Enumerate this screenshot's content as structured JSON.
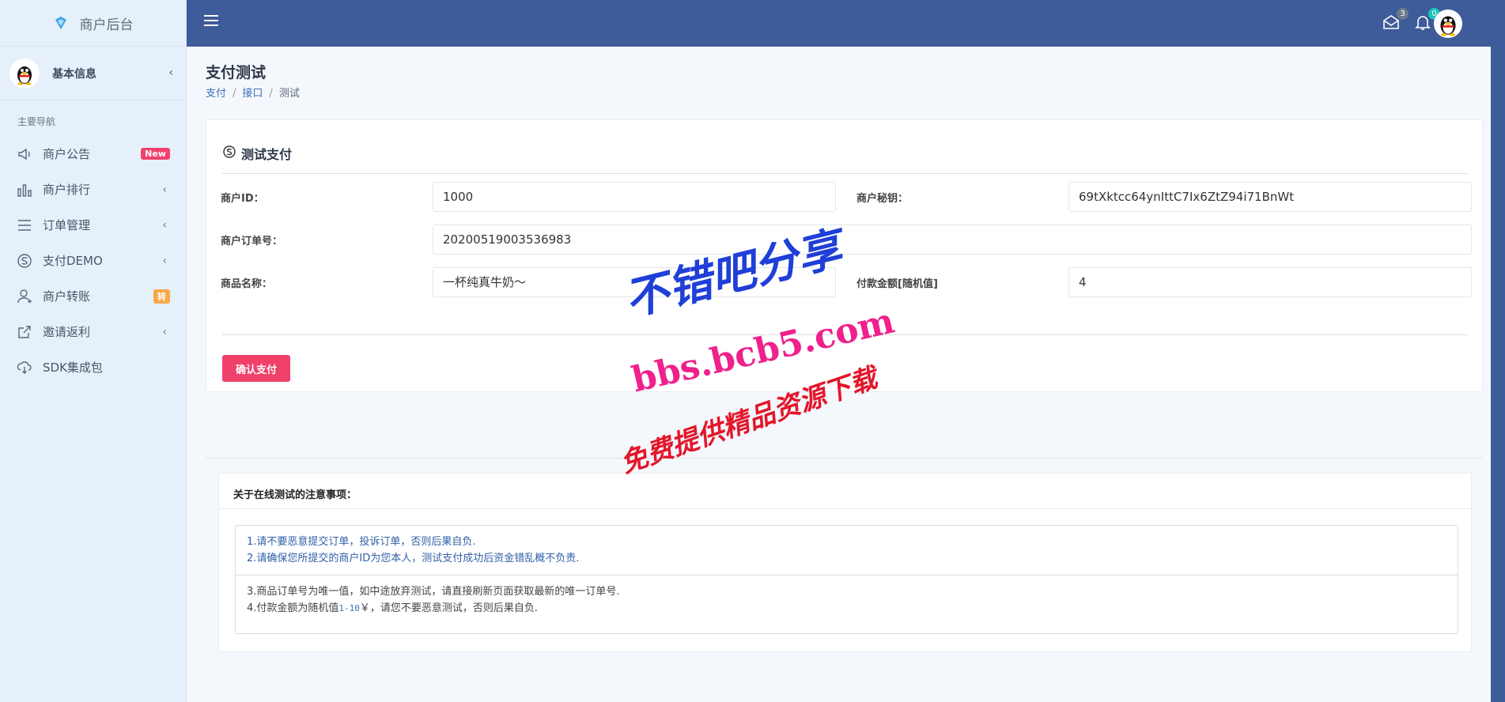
{
  "brand": {
    "title": "商户后台"
  },
  "user": {
    "name": "基本信息"
  },
  "nav": {
    "section_title": "主要导航",
    "items": [
      {
        "label": "商户公告",
        "badge": "New"
      },
      {
        "label": "商户排行"
      },
      {
        "label": "订单管理"
      },
      {
        "label": "支付DEMO"
      },
      {
        "label": "商户转账",
        "badge": "转"
      },
      {
        "label": "邀请返利"
      },
      {
        "label": "SDK集成包"
      }
    ]
  },
  "header": {
    "mail_count": "3",
    "notify_count": "0"
  },
  "page": {
    "title": "支付测试",
    "breadcrumb": [
      "支付",
      "接口",
      "测试"
    ]
  },
  "form": {
    "card_title": "测试支付",
    "merchant_id_label": "商户ID：",
    "merchant_id_value": "1000",
    "merchant_key_label": "商户秘钥：",
    "merchant_key_value": "69tXktcc64ynIttC7Ix6ZtZ94i71BnWt",
    "order_no_label": "商户订单号：",
    "order_no_value": "20200519003536983",
    "product_label": "商品名称：",
    "product_value": "一杯纯真牛奶～",
    "amount_label": "付款金额[随机值]",
    "amount_value": "4",
    "submit_label": "确认支付"
  },
  "notice": {
    "title": "关于在线测试的注意事项：",
    "line1": "1.请不要恶意提交订单，投诉订单，否则后果自负.",
    "line2": "2.请确保您所提交的商户ID为您本人，测试支付成功后资金错乱概不负责.",
    "line3": "3.商品订单号为唯一值，如中途放弃测试，请直接刷新页面获取最新的唯一订单号.",
    "line4_pre": "4.付款金额为随机值",
    "line4_code": "1-10",
    "line4_post": "￥，请您不要恶意测试，否则后果自负."
  },
  "watermark": {
    "line1": "不错吧分享",
    "line2": "bbs.bcb5.com",
    "line3": "免费提供精品资源下载"
  },
  "colors": {
    "header_bg": "#3e5b9a",
    "sidebar_bg": "#e6f0fb",
    "primary_button": "#f0416a",
    "badge_new": "#f1416c",
    "badge_orange": "#f8a84a",
    "mail_badge": "#6c7a8e",
    "notify_badge": "#1bc5bd"
  }
}
